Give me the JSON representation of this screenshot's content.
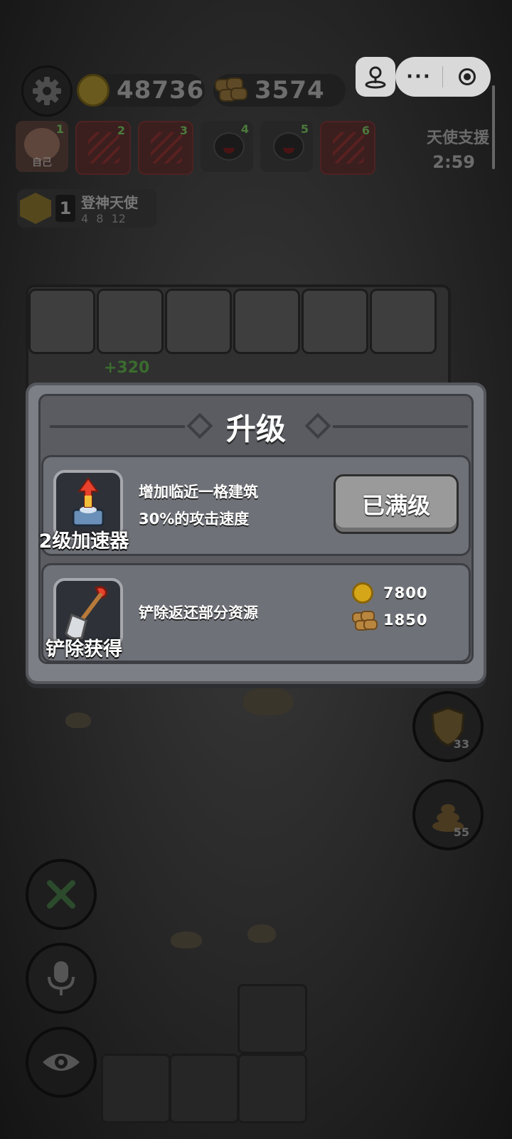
{
  "resources": {
    "gold": "48736",
    "wood": "3574"
  },
  "players": [
    {
      "num": "1",
      "label": "自己",
      "state": "self"
    },
    {
      "num": "2",
      "state": "dead"
    },
    {
      "num": "3",
      "state": "dead"
    },
    {
      "num": "4",
      "state": "alive"
    },
    {
      "num": "5",
      "state": "alive"
    },
    {
      "num": "6",
      "state": "dead"
    }
  ],
  "angel": {
    "label": "天使支援",
    "timer": "2:59"
  },
  "rank": {
    "level": "1",
    "title": "登神天使",
    "thresholds": "4 8 12"
  },
  "floating_text": "+320",
  "dialog": {
    "title": "升级",
    "upgrade": {
      "item_name": "2级加速器",
      "description_line1": "增加临近一格建筑",
      "description_line2": "30%的攻击速度",
      "button_label": "已满级"
    },
    "remove": {
      "item_name": "铲除获得",
      "description": "铲除返还部分资源",
      "gold_refund": "7800",
      "wood_refund": "1850"
    }
  },
  "side_buttons": {
    "shield_count": "33",
    "poop_count": "55"
  },
  "icons": {
    "settings": "gear-icon",
    "gold": "coin-icon",
    "wood": "wood-logs-icon",
    "build": "hammer-wrench-icon",
    "voice": "microphone-icon",
    "view": "eye-icon"
  },
  "colors": {
    "dialog_bg": "#7c7f85",
    "coin": "#d6a619",
    "button_disabled": "#9a9a9a"
  }
}
